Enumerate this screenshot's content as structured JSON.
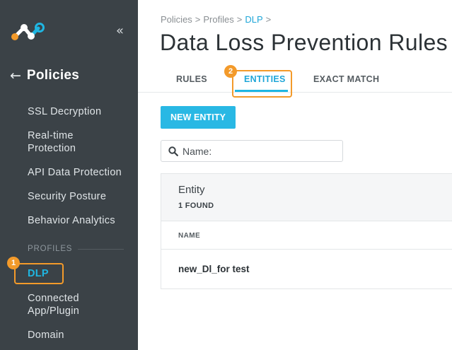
{
  "sidebar": {
    "back_label": "Policies",
    "items": [
      {
        "label": "SSL Decryption"
      },
      {
        "label": "Real-time Protection"
      },
      {
        "label": "API Data Protection"
      },
      {
        "label": "Security Posture"
      },
      {
        "label": "Behavior Analytics"
      }
    ],
    "profiles_header": "PROFILES",
    "profile_items": [
      {
        "label": "DLP",
        "active": true
      },
      {
        "label": "Connected App/Plugin"
      },
      {
        "label": "Domain"
      }
    ],
    "badge_1": "1"
  },
  "breadcrumb": {
    "items": [
      "Policies",
      "Profiles",
      "DLP"
    ],
    "separator": ">"
  },
  "page": {
    "title": "Data Loss Prevention Rules"
  },
  "tabs": {
    "items": [
      {
        "label": "RULES"
      },
      {
        "label": "ENTITIES",
        "active": true
      },
      {
        "label": "EXACT MATCH"
      }
    ],
    "badge_2": "2"
  },
  "toolbar": {
    "new_entity_label": "NEW ENTITY"
  },
  "search": {
    "placeholder": "Name:",
    "value": ""
  },
  "entity_panel": {
    "title": "Entity",
    "count_text": "1 FOUND",
    "column_header": "NAME",
    "rows": [
      {
        "name": "new_Dl_for test"
      }
    ]
  },
  "colors": {
    "sidebar_bg": "#3b4247",
    "accent": "#1fb6e2",
    "annotation": "#f39a2a",
    "logo_orange": "#f39a2a",
    "logo_blue": "#1fb6e2"
  },
  "icons": [
    "logo-icon",
    "collapse-icon",
    "back-arrow-icon",
    "search-icon"
  ]
}
